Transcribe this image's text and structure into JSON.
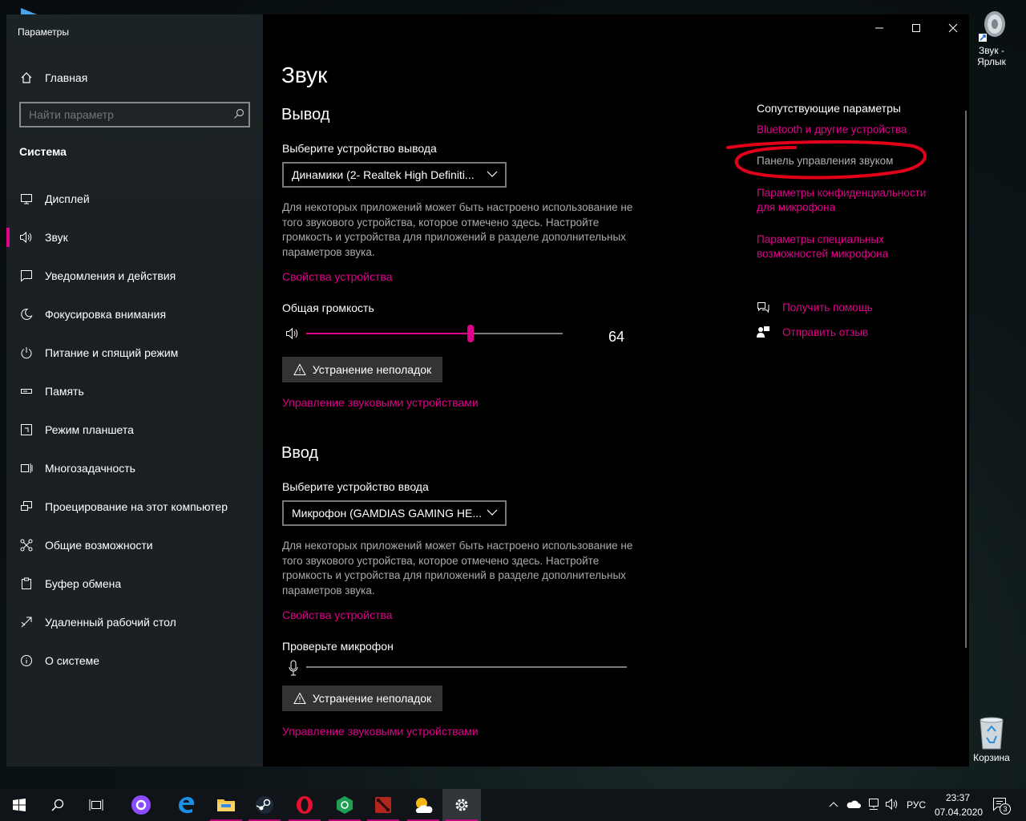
{
  "desktop": {
    "sound_shortcut_label": "Звук - Ярлык",
    "recycle_bin_label": "Корзина"
  },
  "window": {
    "app_title": "Параметры"
  },
  "sidebar": {
    "home_label": "Главная",
    "search_placeholder": "Найти параметр",
    "section_label": "Система",
    "items": [
      {
        "label": "Дисплей",
        "icon": "monitor-icon"
      },
      {
        "label": "Звук",
        "icon": "speaker-icon",
        "active": true
      },
      {
        "label": "Уведомления и действия",
        "icon": "notification-icon"
      },
      {
        "label": "Фокусировка внимания",
        "icon": "moon-icon"
      },
      {
        "label": "Питание и спящий режим",
        "icon": "power-icon"
      },
      {
        "label": "Память",
        "icon": "storage-icon"
      },
      {
        "label": "Режим планшета",
        "icon": "tablet-icon"
      },
      {
        "label": "Многозадачность",
        "icon": "multitask-icon"
      },
      {
        "label": "Проецирование на этот компьютер",
        "icon": "project-icon"
      },
      {
        "label": "Общие возможности",
        "icon": "shared-icon"
      },
      {
        "label": "Буфер обмена",
        "icon": "clipboard-icon"
      },
      {
        "label": "Удаленный рабочий стол",
        "icon": "remote-icon"
      },
      {
        "label": "О системе",
        "icon": "info-icon"
      }
    ]
  },
  "main": {
    "page_title": "Звук",
    "output": {
      "heading": "Вывод",
      "select_label": "Выберите устройство вывода",
      "device": "Динамики (2- Realtek High Definiti...",
      "description": "Для некоторых приложений может быть настроено использование не того звукового устройства, которое отмечено здесь. Настройте громкость и устройства для приложений в разделе дополнительных параметров звука.",
      "properties_link": "Свойства устройства",
      "volume_label": "Общая громкость",
      "volume_value": "64",
      "volume_fraction": 0.64,
      "troubleshoot_label": "Устранение неполадок",
      "manage_link": "Управление звуковыми устройствами"
    },
    "input": {
      "heading": "Ввод",
      "select_label": "Выберите устройство ввода",
      "device": "Микрофон (GAMDIAS GAMING HE...",
      "description": "Для некоторых приложений может быть настроено использование не того звукового устройства, которое отмечено здесь. Настройте громкость и устройства для приложений в разделе дополнительных параметров звука.",
      "properties_link": "Свойства устройства",
      "test_label": "Проверьте микрофон",
      "troubleshoot_label": "Устранение неполадок",
      "manage_link": "Управление звуковыми устройствами"
    }
  },
  "related": {
    "heading": "Сопутствующие параметры",
    "links": [
      "Bluetooth и другие устройства",
      "Панель управления звуком",
      "Параметры конфиденциальности для микрофона",
      "Параметры специальных возможностей микрофона"
    ],
    "help_link": "Получить помощь",
    "feedback_link": "Отправить отзыв"
  },
  "taskbar": {
    "language": "РУС",
    "time": "23:37",
    "date": "07.04.2020",
    "notification_count": "3"
  },
  "colors": {
    "accent": "#e3008c",
    "annotation": "#e0001a"
  }
}
